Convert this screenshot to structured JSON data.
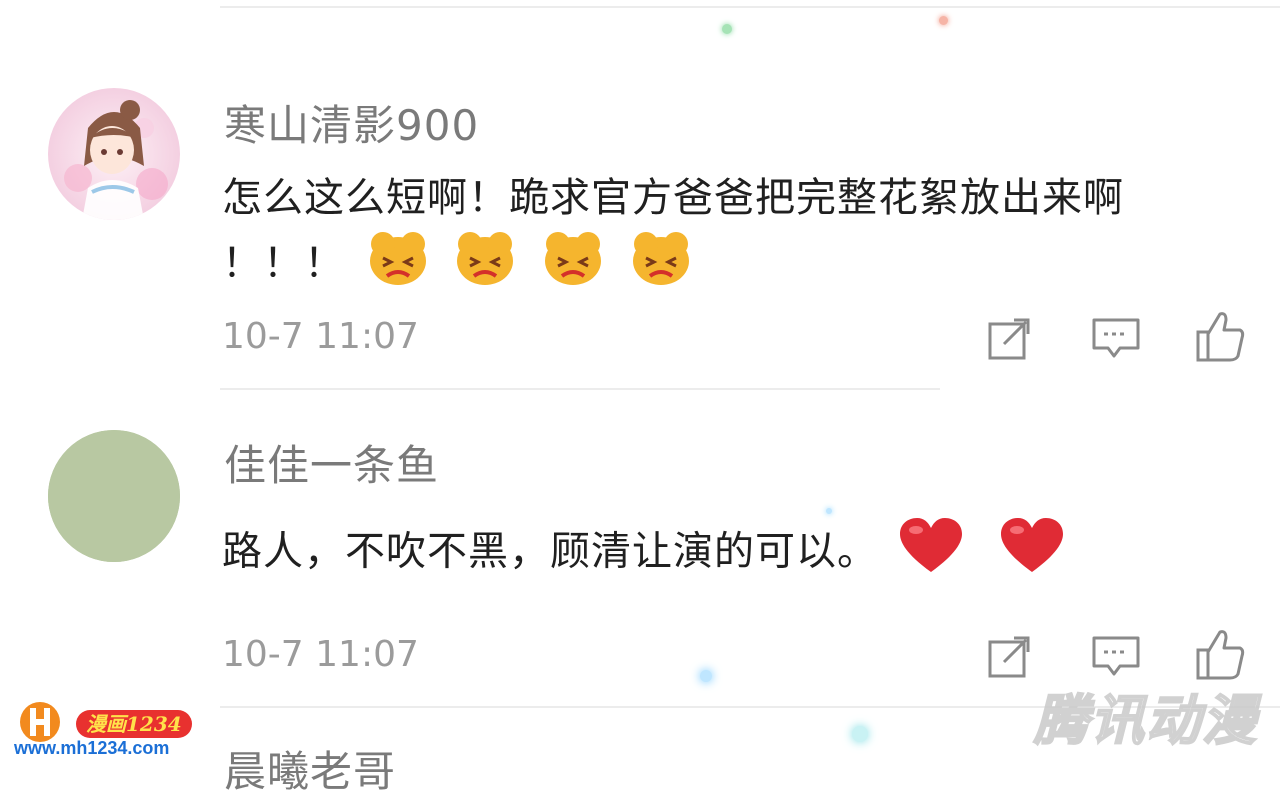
{
  "comments": [
    {
      "username": "寒山清影900",
      "text_line1": "怎么这么短啊！跪求官方爸爸把完整花絮放出来啊",
      "text_line2": "！！！",
      "emoji": [
        "persevering-face",
        "persevering-face",
        "persevering-face",
        "persevering-face"
      ],
      "timestamp": "10-7 11:07",
      "avatar": "anime-girl-avatar"
    },
    {
      "username": "佳佳一条鱼",
      "text_line1": "路人，不吹不黑，顾清让演的可以。",
      "emoji": [
        "red-heart",
        "red-heart"
      ],
      "timestamp": "10-7 11:07",
      "avatar": "plain-green-avatar"
    },
    {
      "username": "晨曦老哥"
    }
  ],
  "actions": [
    "share-icon",
    "reply-icon",
    "like-icon"
  ],
  "watermark_left": {
    "badge": "漫画1234",
    "url": "www.mh1234.com"
  },
  "watermark_right": "腾讯动漫",
  "colors": {
    "username": "#7a7a7a",
    "text": "#202020",
    "timestamp": "#9b9b9b",
    "icon": "#8a8a8a",
    "divider": "#ececec",
    "heart": "#e02b35",
    "emoji_face": "#f5b52e"
  }
}
